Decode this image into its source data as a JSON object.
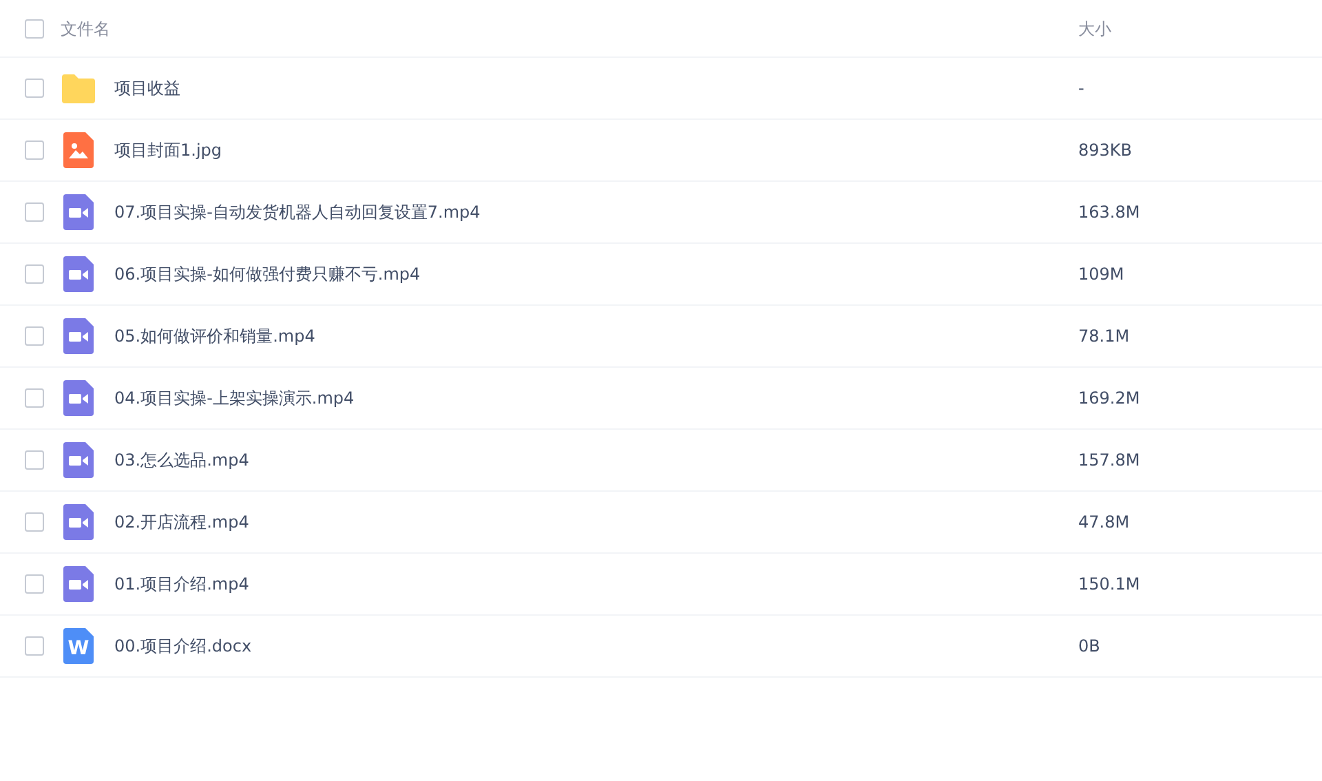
{
  "table": {
    "select_all": {
      "checked": false
    },
    "columns": [
      "文件名",
      "大小"
    ],
    "rows": [
      {
        "kind": "folder",
        "name": "项目收益",
        "size": "-",
        "checked": false
      },
      {
        "kind": "image",
        "name": "项目封面1.jpg",
        "size": "893KB",
        "checked": false
      },
      {
        "kind": "video",
        "name": "07.项目实操-自动发货机器人自动回复设置7.mp4",
        "size": "163.8M",
        "checked": false
      },
      {
        "kind": "video",
        "name": "06.项目实操-如何做强付费只赚不亏.mp4",
        "size": "109M",
        "checked": false
      },
      {
        "kind": "video",
        "name": "05.如何做评价和销量.mp4",
        "size": "78.1M",
        "checked": false
      },
      {
        "kind": "video",
        "name": "04.项目实操-上架实操演示.mp4",
        "size": "169.2M",
        "checked": false
      },
      {
        "kind": "video",
        "name": "03.怎么选品.mp4",
        "size": "157.8M",
        "checked": false
      },
      {
        "kind": "video",
        "name": "02.开店流程.mp4",
        "size": "47.8M",
        "checked": false
      },
      {
        "kind": "video",
        "name": "01.项目介绍.mp4",
        "size": "150.1M",
        "checked": false
      },
      {
        "kind": "doc",
        "icon_text": "W",
        "name": "00.项目介绍.docx",
        "size": "0B",
        "checked": false
      }
    ]
  }
}
